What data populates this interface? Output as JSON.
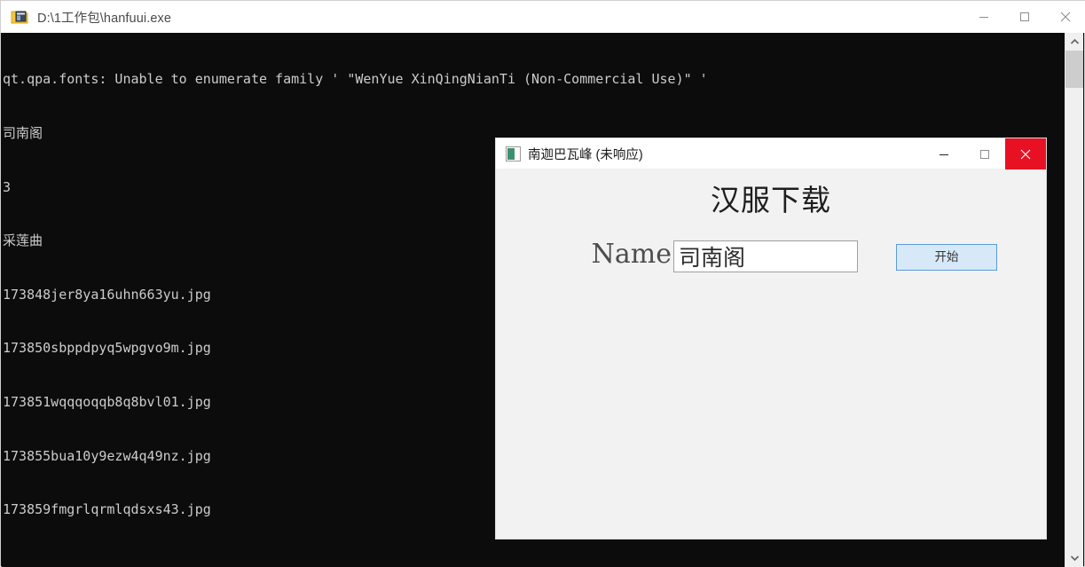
{
  "console_window": {
    "title": "D:\\1工作包\\hanfuui.exe",
    "icon": "exe-folder-icon",
    "controls": {
      "minimize": "minimize-icon",
      "maximize": "maximize-icon",
      "close": "close-icon"
    },
    "background_color": "#0c0c0c",
    "text_color": "#cccccc",
    "lines": [
      "qt.qpa.fonts: Unable to enumerate family ' \"WenYue XinQingNianTi (Non-Commercial Use)\" '",
      "司南阁",
      "3",
      "采莲曲",
      "173848jer8ya16uhn663yu.jpg",
      "173850sbppdpyq5wpgvo9m.jpg",
      "173851wqqqoqqb8q8bvl01.jpg",
      "173855bua10y9ezw4q49nz.jpg",
      "173859fmgrlqrmlqdsxs43.jpg"
    ],
    "scrollbar": {
      "up_arrow": "chevron-up-icon",
      "down_arrow": "chevron-down-icon"
    }
  },
  "dialog": {
    "title": "南迦巴瓦峰 (未响应)",
    "icon": "app-window-icon",
    "controls": {
      "minimize": "minimize-icon",
      "maximize": "maximize-icon",
      "close": "close-icon"
    },
    "close_button_color": "#e81123",
    "heading": "汉服下载",
    "name_label": "Name",
    "name_value": "司南阁",
    "name_placeholder": "",
    "start_label": "开始",
    "start_button_color": "#d7e9f8",
    "start_button_border": "#5b9bd5",
    "background_color": "#f2f2f2"
  }
}
